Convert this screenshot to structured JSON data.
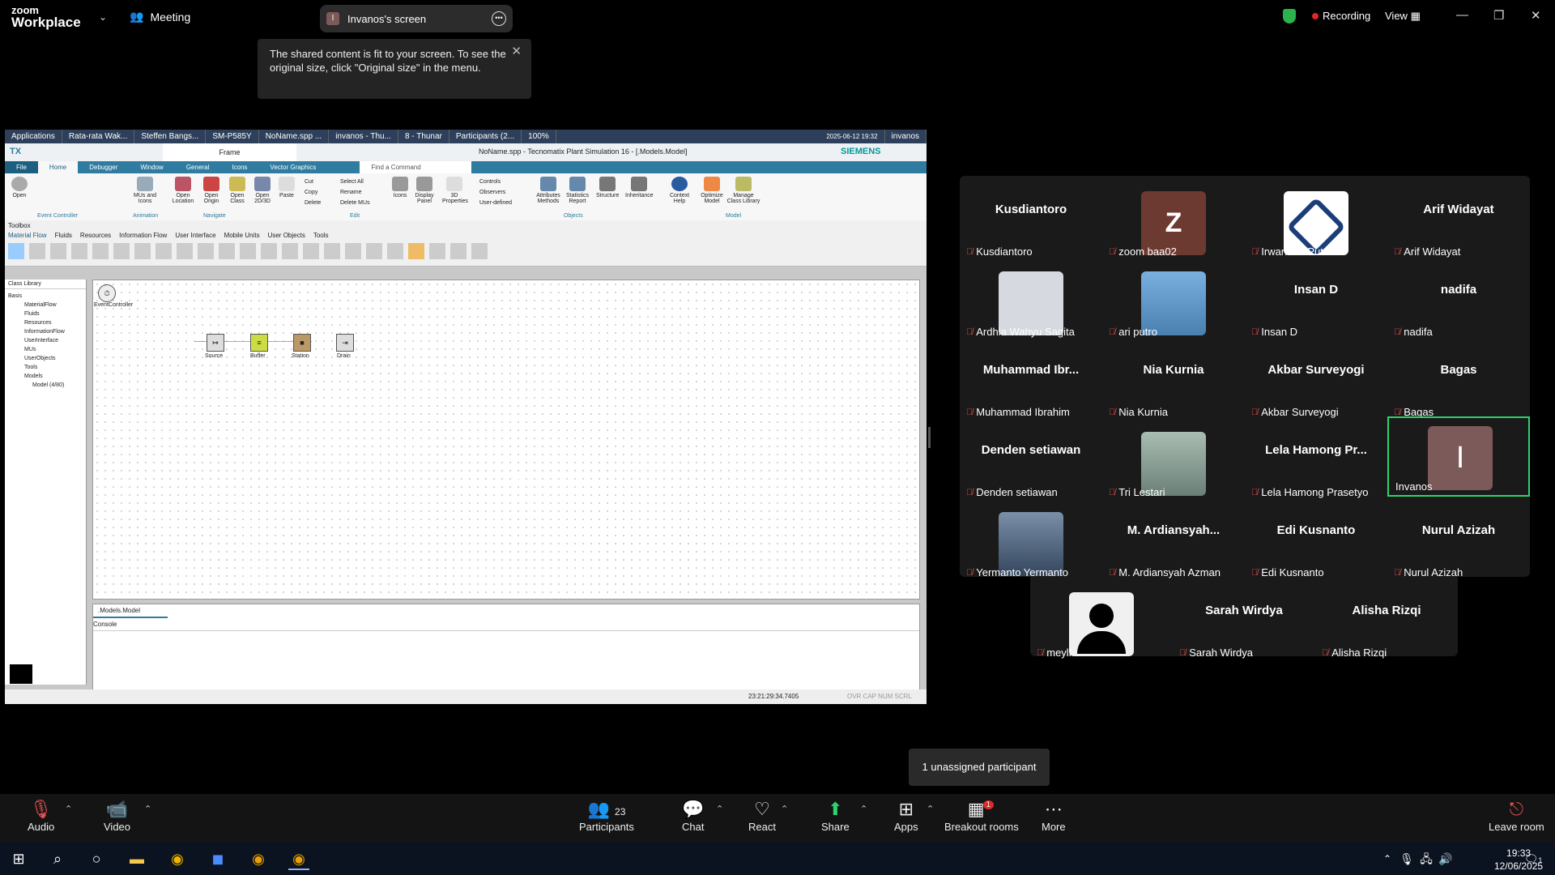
{
  "app": {
    "brand_line1": "zoom",
    "brand_line2": "Workplace",
    "meeting_label": "Meeting"
  },
  "share": {
    "presenter_initial": "I",
    "presenter_label": "Invanos's screen"
  },
  "status": {
    "recording_label": "Recording",
    "view_label": "View"
  },
  "tooltip": {
    "text": "The shared content is fit to your screen. To see the original size, click \"Original size\" in the menu."
  },
  "shared_screen": {
    "taskbar_items": [
      "Applications",
      "Rata-rata Wak...",
      "Steffen Bangs...",
      "SM-P585Y",
      "NoName.spp ...",
      "invanos - Thu...",
      "8 - Thunar",
      "Participants (2...",
      "100%"
    ],
    "taskbar_clock": "2025-06-12 19:32",
    "taskbar_user": "invanos",
    "app_logo": "TX",
    "frame_tab": "Frame",
    "find_command": "Find a Command",
    "window_title": "NoName.spp - Tecnomatix Plant Simulation 16 - [.Models.Model]",
    "vendor": "SIEMENS",
    "ribbon_tabs": [
      "File",
      "Home",
      "Debugger",
      "Window",
      "General",
      "Icons",
      "Vector Graphics"
    ],
    "ribbon_buttons": [
      "Open",
      "MUs and Icons",
      "Open Location",
      "Open Origin",
      "Open Class",
      "Open 2D/3D",
      "Paste",
      "Cut",
      "Copy",
      "Delete",
      "Select All",
      "Rename",
      "Delete MUs",
      "Icons",
      "Display Panel",
      "3D Properties",
      "Controls",
      "Observers",
      "User-defined",
      "Attributes Methods",
      "Statistics Report",
      "Structure",
      "Inheritance",
      "Context Help",
      "Optimize Model",
      "Manage Class Library"
    ],
    "ribbon_groups": [
      "Event Controller",
      "Animation",
      "Navigate",
      "Edit",
      "Objects",
      "Model"
    ],
    "toolbox_label": "Toolbox",
    "toolbox_tabs": [
      "Material Flow",
      "Fluids",
      "Resources",
      "Information Flow",
      "User Interface",
      "Mobile Units",
      "User Objects",
      "Tools"
    ],
    "class_library_label": "Class Library",
    "class_tree": [
      "Basis",
      "MaterialFlow",
      "Fluids",
      "Resources",
      "InformationFlow",
      "UserInterface",
      "MUs",
      "UserObjects",
      "Tools",
      "Models",
      "Model (4/80)"
    ],
    "model_objects": [
      "EventController",
      "Source",
      "Buffer",
      "Station",
      "Drain"
    ],
    "model_tab": ".Models.Model",
    "console_label": "Console",
    "sim_time": "23:21:29:34.7405",
    "status_flags": "OVR CAP NUM SCRL"
  },
  "participants": [
    {
      "big": "Kusdiantoro",
      "label": "Kusdiantoro",
      "type": "name"
    },
    {
      "big": "Z",
      "label": "zoom baa02",
      "type": "avatar",
      "color": "#6d3a32"
    },
    {
      "big": "",
      "label": "Irwan Adi Putra",
      "type": "logo"
    },
    {
      "big": "Arif Widayat",
      "label": "Arif Widayat",
      "type": "name"
    },
    {
      "big": "",
      "label": "Ardhia Wahyu Sagita",
      "type": "photo",
      "color": "#d6d9df"
    },
    {
      "big": "",
      "label": "ari putro",
      "type": "photo",
      "color": "#5b8fc0"
    },
    {
      "big": "Insan D",
      "label": "Insan D",
      "type": "name"
    },
    {
      "big": "nadifa",
      "label": "nadifa",
      "type": "name"
    },
    {
      "big": "Muhammad Ibr...",
      "label": "Muhammad Ibrahim",
      "type": "name"
    },
    {
      "big": "Nia Kurnia",
      "label": "Nia Kurnia",
      "type": "name"
    },
    {
      "big": "Akbar Surveyogi",
      "label": "Akbar Surveyogi",
      "type": "name"
    },
    {
      "big": "Bagas",
      "label": "Bagas",
      "type": "name"
    },
    {
      "big": "Denden setiawan",
      "label": "Denden setiawan",
      "type": "name"
    },
    {
      "big": "",
      "label": "Tri Lestari",
      "type": "photo",
      "color": "#7a8f86"
    },
    {
      "big": "Lela Hamong Pr...",
      "label": "Lela Hamong Prasetyo",
      "type": "name"
    },
    {
      "big": "I",
      "label": "Invanos",
      "type": "avatar",
      "color": "#7d5a5a",
      "active": true
    },
    {
      "big": "",
      "label": "Yermanto Yermanto",
      "type": "photo",
      "color": "#4a5f7a"
    },
    {
      "big": "M. Ardiansyah...",
      "label": "M. Ardiansyah Azman",
      "type": "name"
    },
    {
      "big": "Edi Kusnanto",
      "label": "Edi Kusnanto",
      "type": "name"
    },
    {
      "big": "Nurul Azizah",
      "label": "Nurul Azizah",
      "type": "name"
    },
    {
      "big": "",
      "label": "meyll",
      "type": "photo",
      "color": "#e8e8e8"
    },
    {
      "big": "Sarah Wirdya",
      "label": "Sarah Wirdya",
      "type": "name"
    },
    {
      "big": "Alisha Rizqi",
      "label": "Alisha Rizqi",
      "type": "name"
    }
  ],
  "unassigned": "1 unassigned participant",
  "toolbar": {
    "audio": "Audio",
    "video": "Video",
    "participants": "Participants",
    "participants_count": "23",
    "chat": "Chat",
    "react": "React",
    "share": "Share",
    "apps": "Apps",
    "breakout": "Breakout rooms",
    "breakout_badge": "1",
    "more": "More",
    "leave": "Leave room"
  },
  "os_taskbar": {
    "time": "19:33",
    "date": "12/06/2025",
    "notif_count": "1"
  }
}
